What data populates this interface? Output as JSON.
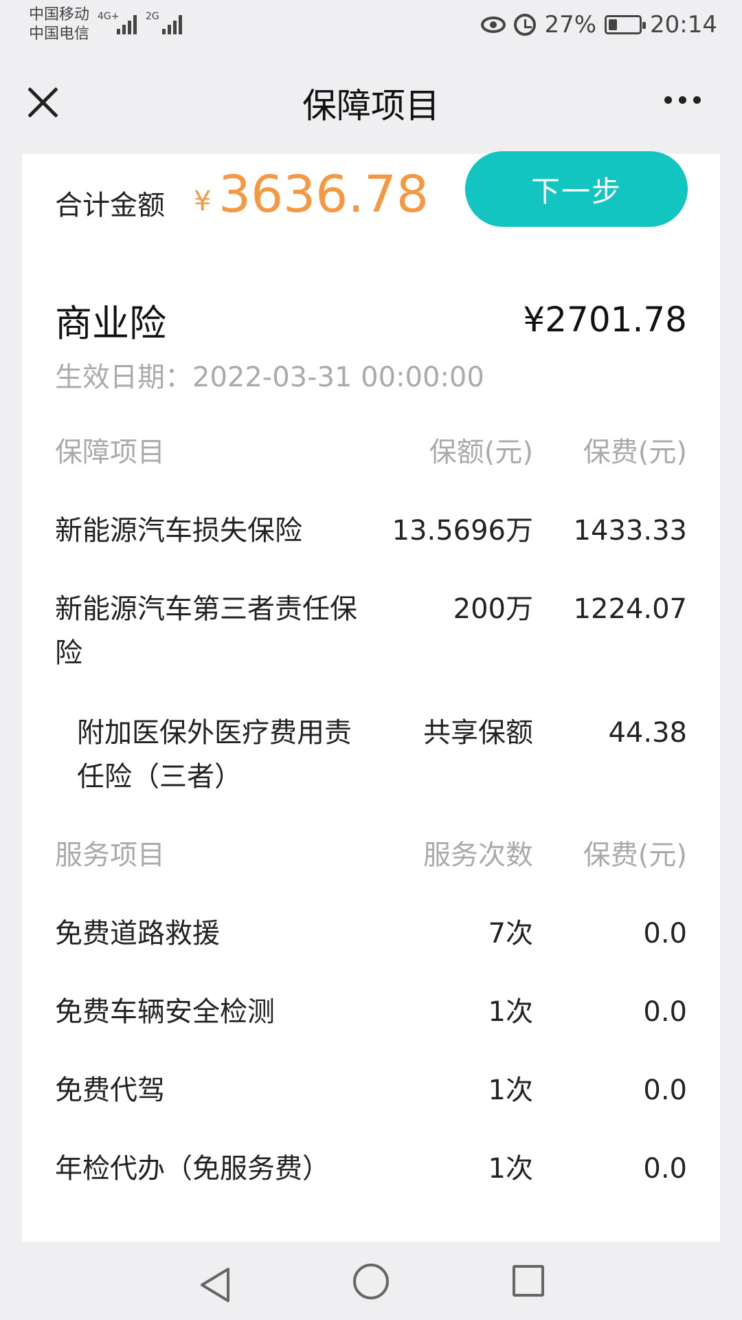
{
  "status_bar": {
    "carrier1": "中国移动",
    "carrier2": "中国电信",
    "net1": "4G+",
    "net2": "2G",
    "battery_pct": "27%",
    "time": "20:14"
  },
  "nav": {
    "title": "保障项目"
  },
  "summary": {
    "total_label": "合计金额",
    "currency": "¥",
    "total_amount": "3636.78",
    "next_label": "下一步"
  },
  "commercial": {
    "title": "商业险",
    "amount": "¥2701.78",
    "effective": "生效日期：2022-03-31 00:00:00"
  },
  "coverage_header": {
    "c1": "保障项目",
    "c2": "保额(元)",
    "c3": "保费(元)"
  },
  "coverage_rows": [
    {
      "name": "新能源汽车损失保险",
      "amount": "13.5696万",
      "premium": "1433.33"
    },
    {
      "name": "新能源汽车第三者责任保险",
      "amount": "200万",
      "premium": "1224.07"
    },
    {
      "name": "附加医保外医疗费用责任险（三者）",
      "amount": "共享保额",
      "premium": "44.38"
    }
  ],
  "service_header": {
    "c1": "服务项目",
    "c2": "服务次数",
    "c3": "保费(元)"
  },
  "service_rows": [
    {
      "name": "免费道路救援",
      "times": "7次",
      "premium": "0.0"
    },
    {
      "name": "免费车辆安全检测",
      "times": "1次",
      "premium": "0.0"
    },
    {
      "name": "免费代驾",
      "times": "1次",
      "premium": "0.0"
    },
    {
      "name": "年检代办（免服务费）",
      "times": "1次",
      "premium": "0.0"
    }
  ],
  "colors": {
    "accent_teal": "#12c5c1",
    "amount_orange": "#f59842",
    "muted_gray": "#aaaaaa",
    "background": "#efeff1"
  }
}
